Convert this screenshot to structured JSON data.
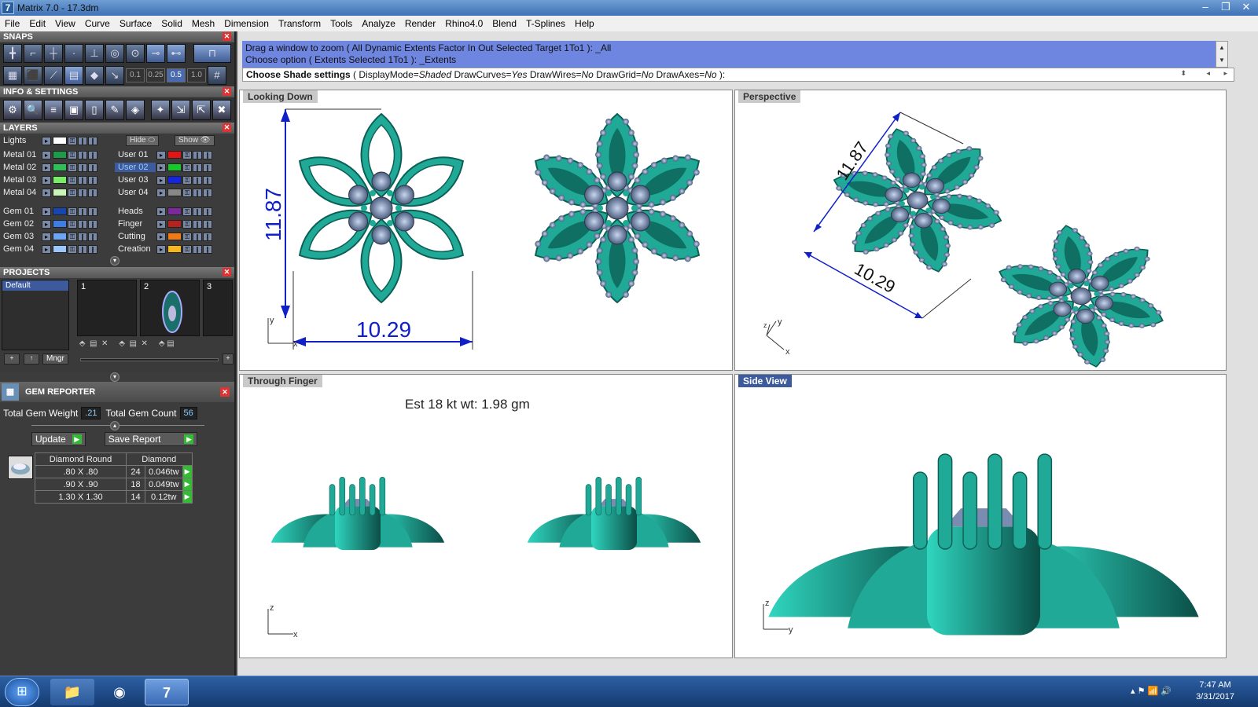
{
  "window": {
    "title": "Matrix 7.0 - 17.3dm",
    "app_icon": "7"
  },
  "menu": [
    "File",
    "Edit",
    "View",
    "Curve",
    "Surface",
    "Solid",
    "Mesh",
    "Dimension",
    "Transform",
    "Tools",
    "Analyze",
    "Render",
    "Rhino4.0",
    "Blend",
    "T-Splines",
    "Help"
  ],
  "panels": {
    "snaps": "SNAPS",
    "info": "INFO & SETTINGS",
    "layers": "LAYERS",
    "projects": "PROJECTS",
    "gem": "GEM REPORTER"
  },
  "snap_values": [
    "0.1",
    "0.25",
    "0.5",
    "1.0"
  ],
  "layers": {
    "lights": "Lights",
    "hide": "Hide",
    "show": "Show",
    "left": [
      {
        "name": "Metal 01",
        "color": "#1d9a4a"
      },
      {
        "name": "Metal 02",
        "color": "#2fbf58"
      },
      {
        "name": "Metal 03",
        "color": "#77ee66"
      },
      {
        "name": "Metal 04",
        "color": "#c8f5b8"
      },
      {
        "name": "Gem 01",
        "color": "#1646b0"
      },
      {
        "name": "Gem 02",
        "color": "#3e7ee4"
      },
      {
        "name": "Gem 03",
        "color": "#6aa6f5"
      },
      {
        "name": "Gem 04",
        "color": "#9cc7fb"
      }
    ],
    "right": [
      {
        "name": "User 01",
        "color": "#e21414"
      },
      {
        "name": "User 02",
        "color": "#17c927"
      },
      {
        "name": "User 03",
        "color": "#1524e3"
      },
      {
        "name": "User 04",
        "color": "#888888"
      },
      {
        "name": "Heads",
        "color": "#7a2a9c"
      },
      {
        "name": "Finger",
        "color": "#b52222"
      },
      {
        "name": "Cutting",
        "color": "#f27a14"
      },
      {
        "name": "Creation",
        "color": "#f5b71d"
      }
    ]
  },
  "projects": {
    "default": "Default",
    "slots": [
      "1",
      "2",
      "3"
    ],
    "mngr": "Mngr"
  },
  "gem_reporter": {
    "total_weight_label": "Total Gem Weight",
    "total_weight": ".21",
    "total_count_label": "Total Gem Count",
    "total_count": "56",
    "update": "Update",
    "save_report": "Save Report",
    "columns": [
      "Diamond Round",
      "Diamond"
    ],
    "rows": [
      {
        "size": ".80 X .80",
        "count": "24",
        "tw": "0.046tw"
      },
      {
        "size": ".90 X .90",
        "count": "18",
        "tw": "0.049tw"
      },
      {
        "size": "1.30 X 1.30",
        "count": "14",
        "tw": "0.12tw"
      }
    ]
  },
  "command": {
    "line1": "Drag a window to zoom ( All  Dynamic  Extents  Factor  In  Out  Selected  Target  1To1 ): _All",
    "line2": "Choose option ( Extents  Selected  1To1 ): _Extents",
    "prompt": "Choose Shade settings",
    "opt_prefix": "( DisplayMode=",
    "v1": "Shaded",
    "k2": " DrawCurves=",
    "v2": "Yes",
    "k3": " DrawWires=",
    "v3": "No",
    "k4": " DrawGrid=",
    "v4": "No",
    "k5": " DrawAxes=",
    "v5": "No",
    "opt_suffix": " ):"
  },
  "viewports": {
    "top_left": {
      "title": "Looking Down",
      "dim_v": "11.87",
      "dim_h": "10.29",
      "ax1": "y",
      "ax2": "x"
    },
    "top_right": {
      "title": "Perspective",
      "dim_a": "11.87",
      "dim_b": "10.29",
      "ax1": "y",
      "ax2": "x",
      "ax3": "z"
    },
    "bottom_left": {
      "title": "Through Finger",
      "weight": "Est 18 kt wt: 1.98 gm",
      "ax1": "z",
      "ax2": "x"
    },
    "bottom_right": {
      "title": "Side View",
      "ax1": "z",
      "ax2": "y"
    }
  },
  "taskbar": {
    "time": "7:47 AM",
    "date": "3/31/2017"
  },
  "colors": {
    "metal": "#1fa996",
    "gem": "#7a8db0",
    "dim": "#1020c8",
    "cmd_bg": "#6f86e0"
  }
}
